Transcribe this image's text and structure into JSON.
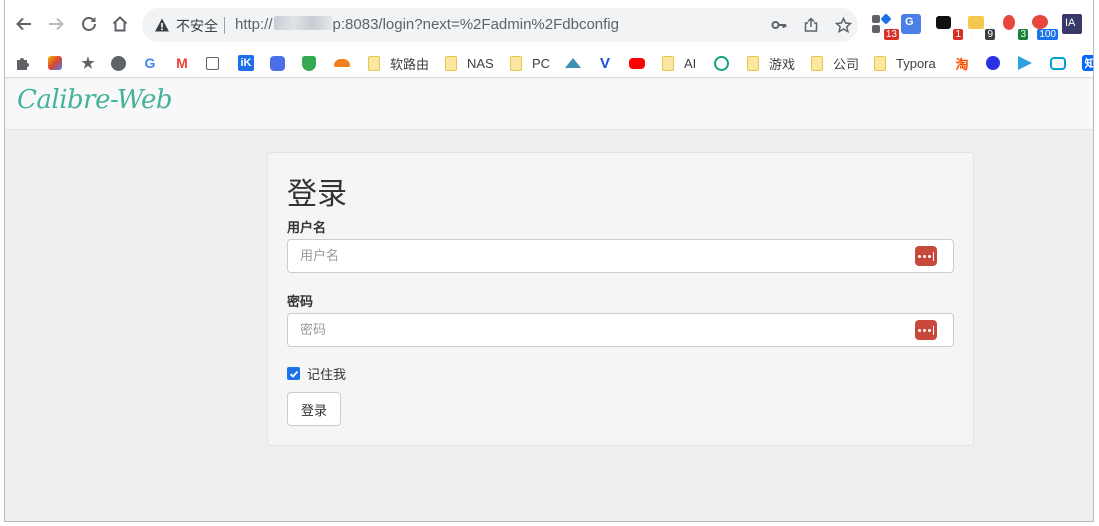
{
  "browser": {
    "address_insecure": "不安全",
    "url_before": "http://",
    "url_after": "p:8083/login?next=%2Fadmin%2Fdbconfig",
    "extensions": [
      {
        "name": "ext-1",
        "badge": "13",
        "color": "#d93025"
      },
      {
        "name": "ext-2",
        "badge": "",
        "color": ""
      },
      {
        "name": "ext-3",
        "badge": "1",
        "color": "#d93025"
      },
      {
        "name": "ext-4",
        "badge": "9",
        "color": "#3c4043"
      },
      {
        "name": "ext-5",
        "badge": "3",
        "color": "#188038"
      },
      {
        "name": "ext-6",
        "badge": "100",
        "color": "#1a73e8"
      },
      {
        "name": "ext-7",
        "badge": "IA",
        "color": "#3a3a6a"
      }
    ]
  },
  "bookmarks": {
    "folder_1": "软路由",
    "folder_2": "NAS",
    "folder_3": "PC",
    "folder_4": "AI",
    "folder_5": "游戏",
    "folder_6": "公司",
    "folder_7": "Typora",
    "taobao": "淘",
    "zhihu": "知"
  },
  "app": {
    "brand": "Calibre-Web",
    "brand_color": "#45b29d"
  },
  "login": {
    "title": "登录",
    "username_label": "用户名",
    "username_placeholder": "用户名",
    "password_label": "密码",
    "password_placeholder": "密码",
    "remember_label": "记住我",
    "remember_checked": true,
    "submit_label": "登录"
  }
}
